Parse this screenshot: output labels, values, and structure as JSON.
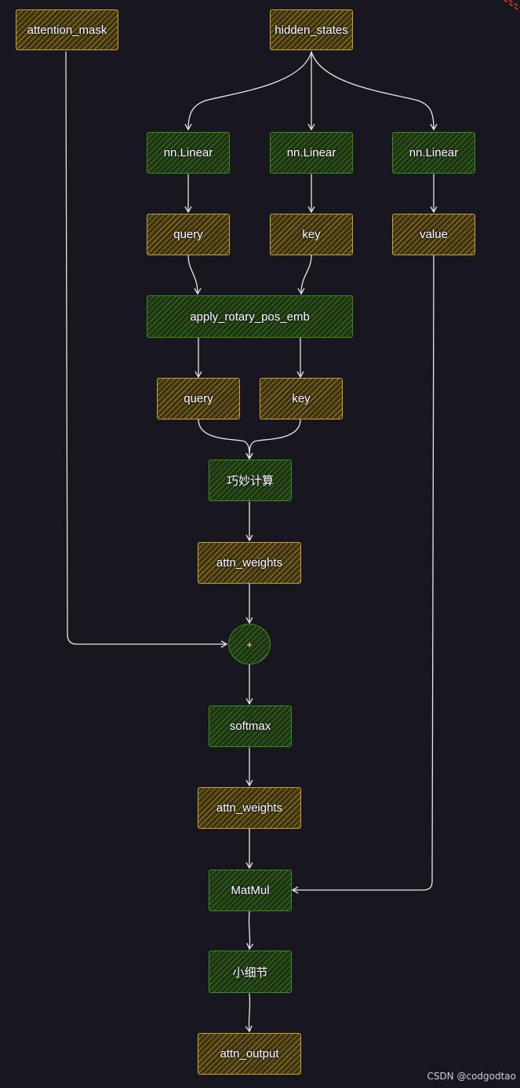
{
  "nodes": {
    "attention_mask": "attention_mask",
    "hidden_states": "hidden_states",
    "linear_q": "nn.Linear",
    "linear_k": "nn.Linear",
    "linear_v": "nn.Linear",
    "query_1": "query",
    "key_1": "key",
    "value": "value",
    "rotary": "apply_rotary_pos_emb",
    "query_2": "query",
    "key_2": "key",
    "compute": "巧妙计算",
    "attn_weights_1": "attn_weights",
    "plus": "+",
    "softmax": "softmax",
    "attn_weights_2": "attn_weights",
    "matmul": "MatMul",
    "detail": "小细节",
    "attn_output": "attn_output"
  },
  "watermark": "CSDN @codgodtao",
  "colors": {
    "background": "#18171f",
    "tensor_stroke": "#c9a227",
    "operation_stroke": "#3e8a1c",
    "arrow": "#e8e8e8"
  }
}
